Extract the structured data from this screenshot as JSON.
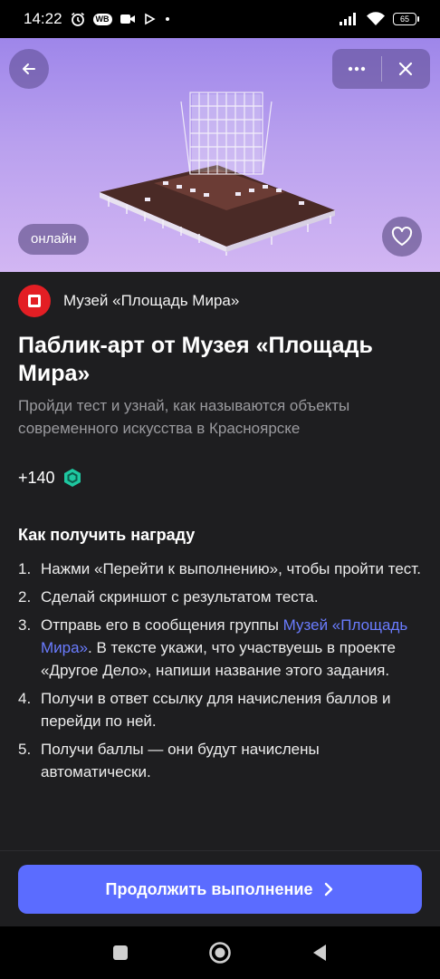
{
  "status_bar": {
    "time": "14:22",
    "wb_badge": "WB",
    "battery": "65",
    "icons": [
      "alarm-icon",
      "wb-badge",
      "video-camera-icon",
      "play-icon",
      "dot-icon",
      "signal-icon",
      "wifi-icon",
      "battery-icon"
    ]
  },
  "hero": {
    "badge": "онлайн",
    "background_colors": [
      "#9e86ea",
      "#d2b6f3"
    ]
  },
  "organizer": {
    "name": "Музей «Площадь Мира»",
    "logo_color": "#e31e24"
  },
  "task": {
    "title": "Паблик-арт от Музея «Площадь Мира»",
    "subtitle": "Пройди тест и узнай, как называются объекты современного искусства в Красноярске",
    "reward": "+140"
  },
  "how_to": {
    "heading": "Как получить награду",
    "steps": [
      {
        "num": "1.",
        "text": "Нажми «Перейти к выполнению», чтобы пройти тест."
      },
      {
        "num": "2.",
        "text": "Сделай скриншот с результатом теста."
      },
      {
        "num": "3.",
        "text_before": "Отправь его в сообщения группы ",
        "link": "Музей «Площадь Мира»",
        "text_after": ". В тексте укажи, что участвуешь в проекте «Другое Дело», напиши название этого задания."
      },
      {
        "num": "4.",
        "text": "Получи в ответ ссылку для начисления баллов и перейди по ней."
      },
      {
        "num": "5.",
        "text": "Получи баллы — они будут начислены автоматически."
      }
    ]
  },
  "cta": {
    "label": "Продолжить выполнение",
    "color": "#5b6cff"
  },
  "colors": {
    "background": "#1e1e20",
    "link": "#6a7cff",
    "reward_icon": "#1ec7a0"
  }
}
